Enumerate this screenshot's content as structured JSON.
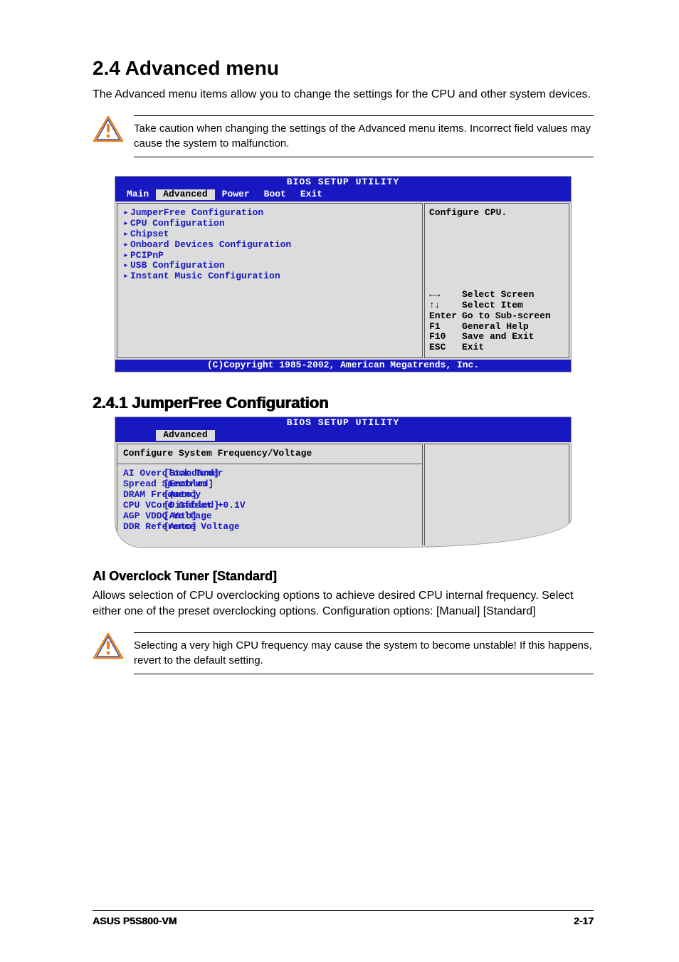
{
  "section": {
    "number": "2.4",
    "title": "Advanced menu",
    "heading_full": "2.4    Advanced menu",
    "intro": "The Advanced menu items allow you to change the settings for the CPU and other system devices."
  },
  "caution1": "Take caution when changing the settings of the Advanced menu items. Incorrect field values may cause the system to malfunction.",
  "bios1": {
    "title": "BIOS SETUP UTILITY",
    "tabs": [
      "Main",
      "Advanced",
      "Power",
      "Boot",
      "Exit"
    ],
    "selected_tab": "Advanced",
    "menu": [
      "JumperFree Configuration",
      "CPU Configuration",
      "Chipset",
      "Onboard Devices Configuration",
      "PCIPnP",
      "USB Configuration",
      "Instant Music Configuration"
    ],
    "help_top": "Configure CPU.",
    "help_keys": [
      {
        "key": "←→",
        "desc": "Select Screen"
      },
      {
        "key": "↑↓",
        "desc": "Select Item"
      },
      {
        "key": "Enter",
        "desc": "Go to Sub-screen"
      },
      {
        "key": "F1",
        "desc": "General Help"
      },
      {
        "key": "F10",
        "desc": "Save and Exit"
      },
      {
        "key": "ESC",
        "desc": "Exit"
      }
    ],
    "copyright": "(C)Copyright 1985-2002, American Megatrends, Inc."
  },
  "subsection": {
    "number": "2.4.1",
    "title": "JumperFree Configuration",
    "heading_full": "2.4.1   JumperFree Configuration"
  },
  "bios2": {
    "title": "BIOS SETUP UTILITY",
    "tab": "Advanced",
    "header": "Configure System Frequency/Voltage",
    "settings": [
      {
        "name": "AI Overclock Tuner",
        "value": "[Standard]"
      },
      {
        "name": "Spread Spectrum",
        "value": "[Enabled]"
      },
      {
        "name": "DRAM Frequency",
        "value": "[Auto]"
      },
      {
        "name": "CPU VCore Offset +0.1V",
        "value": "[Disabled]"
      },
      {
        "name": "AGP VDDQ Voltage",
        "value": "[Auto]"
      },
      {
        "name": "DDR Reference Voltage",
        "value": "[Auto]"
      }
    ]
  },
  "item": {
    "title": "AI Overclock Tuner [Standard]",
    "desc": "Allows selection of CPU overclocking options to achieve desired CPU internal frequency. Select either one of the preset overclocking options. Configuration options: [Manual] [Standard]"
  },
  "caution2": "Selecting a very high CPU frequency may cause the system to become unstable! If this happens, revert to the default setting.",
  "footer": {
    "left": "ASUS P5S800-VM",
    "right": "2-17"
  }
}
